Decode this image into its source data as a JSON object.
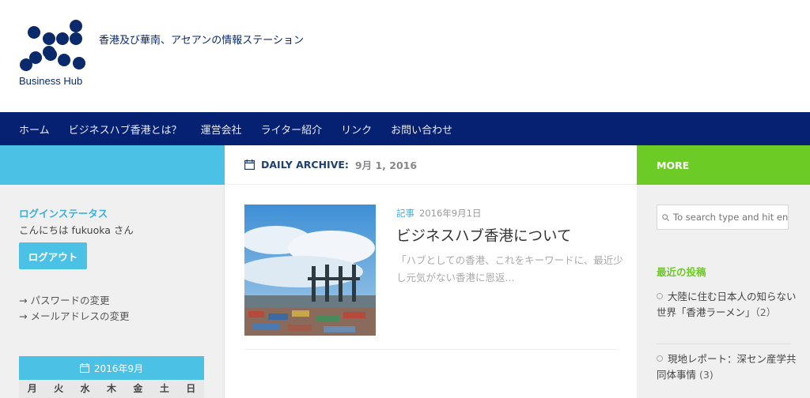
{
  "header": {
    "logo_text": "Business Hub",
    "tagline": "香港及び華南、アセアンの情報ステーション"
  },
  "nav": {
    "items": [
      "ホーム",
      "ビジネスハブ香港とは？",
      "運営会社",
      "ライター紹介",
      "リンク",
      "お問い合わせ"
    ]
  },
  "left_sidebar": {
    "login_title": "ログインステータス",
    "greeting": "こんにちは fukuoka さん",
    "logout_label": "ログアウト",
    "links": [
      "→ パスワードの変更",
      "→ メールアドレスの変更"
    ],
    "calendar": {
      "month_label": "2016年9月",
      "weekdays": [
        "月",
        "火",
        "水",
        "木",
        "金",
        "土",
        "日"
      ]
    }
  },
  "main": {
    "archive_label": "DAILY ARCHIVE:",
    "archive_date": "9月 1, 2016",
    "post": {
      "category": "記事",
      "date": "2016年9月1日",
      "title": "ビジネスハブ香港について",
      "excerpt": "「ハブとしての香港、これをキーワードに、最近少し元気がない香港に恩返..."
    }
  },
  "right_sidebar": {
    "more_label": "MORE",
    "search_placeholder": "To search type and hit enter",
    "recent_title": "最近の投稿",
    "recent_posts": [
      {
        "title": "大陸に住む日本人の知らない世界「香港ラーメン」",
        "count": "（2）"
      },
      {
        "title": "現地レポート：深セン産学共同体事情",
        "count": "(3)"
      }
    ]
  },
  "colors": {
    "nav_bg": "#062072",
    "accent_blue": "#4cc1e6",
    "accent_green": "#6ccb24",
    "logo_navy": "#0b2a6b"
  }
}
